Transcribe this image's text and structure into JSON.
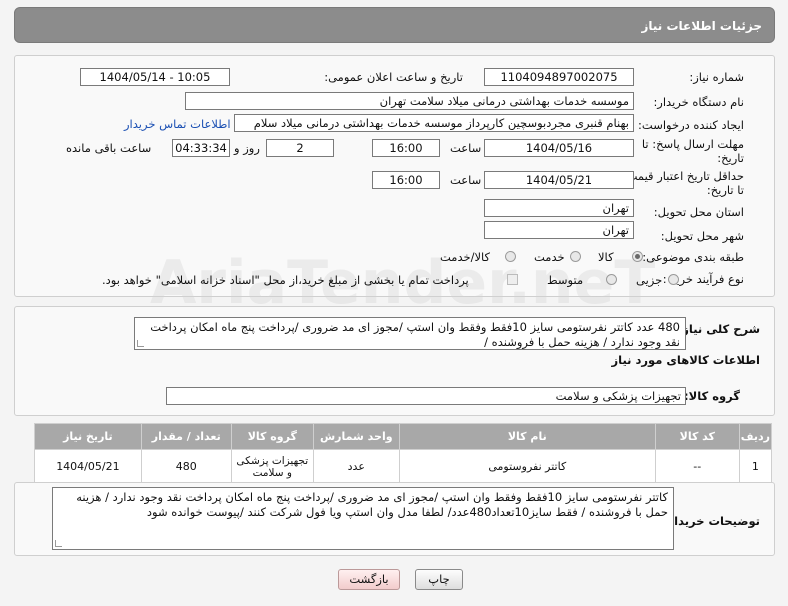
{
  "header": {
    "title": "جزئیات اطلاعات نیاز"
  },
  "fields": {
    "need_number_label": "شماره نیاز:",
    "need_number": "1104094897002075",
    "announce_label": "تاریخ و ساعت اعلان عمومی:",
    "announce_value": "1404/05/14 - 10:05",
    "buyer_label": "نام دستگاه خریدار:",
    "buyer_value": "موسسه خدمات بهداشتی درمانی میلاد سلامت تهران",
    "creator_label": "ایجاد کننده درخواست:",
    "creator_value": "بهنام قنبری مجردبوسچین کارپرداز موسسه خدمات بهداشتی درمانی میلاد سلام",
    "contact_link": "اطلاعات تماس خریدار",
    "reply_deadline_label_1": "مهلت ارسال پاسخ: تا",
    "reply_deadline_label_2": "تاریخ:",
    "reply_date": "1404/05/16",
    "time_label": "ساعت",
    "reply_time": "16:00",
    "days_value": "2",
    "days_label": "روز و",
    "remaining_time": "04:33:34",
    "remaining_label": "ساعت باقی مانده",
    "price_validity_label_1": "حداقل تاریخ اعتبار قیمت:",
    "price_validity_label_2": "تا تاریخ:",
    "price_date": "1404/05/21",
    "price_time": "16:00",
    "province_label": "استان محل تحویل:",
    "province_value": "تهران",
    "city_label": "شهر محل تحویل:",
    "city_value": "تهران",
    "category_label": "طبقه بندی موضوعی:",
    "category_options": [
      "کالا",
      "خدمت",
      "کالا/خدمت"
    ],
    "process_label": "نوع فرآیند خرید :",
    "process_options": [
      "جزیی",
      "متوسط"
    ],
    "payment_note": "پرداخت تمام یا بخشی از مبلغ خرید،از محل \"اسناد خزانه اسلامی\" خواهد بود."
  },
  "description": {
    "label": "شرح کلی نیاز:",
    "text": "480 عدد کاتتر نفرستومی سایز 10فقط  وفقط وان استپ /مجوز ای مد ضروری /پرداخت پنج ماه امکان پرداخت نقد وجود ندارد / هزینه حمل با فروشنده /"
  },
  "goods": {
    "section_title": "اطلاعات کالاهای مورد نیاز",
    "group_label": "گروه کالا:",
    "group_value": "تجهیزات پزشکی و سلامت",
    "columns": [
      "ردیف",
      "کد کالا",
      "نام کالا",
      "واحد شمارش",
      "گروه کالا",
      "تعداد / مقدار",
      "تاریخ نیاز"
    ],
    "rows": [
      [
        "1",
        "--",
        "کاتتر نفروستومی",
        "عدد",
        "تجهیزات پزشکی و سلامت",
        "480",
        "1404/05/21"
      ]
    ]
  },
  "buyer_notes": {
    "label": "توضیحات خریدار:",
    "text": "کاتتر نفرستومی سایز 10فقط  وفقط وان استپ /مجوز ای مد ضروری /پرداخت پنج ماه امکان پرداخت نقد وجود ندارد / هزینه حمل با فروشنده / فقط سایز10تعداد480عدد/ لطفا مدل وان استپ ویا فول شرکت کنند   /پیوست خوانده شود"
  },
  "buttons": {
    "print": "چاپ",
    "back": "بازگشت"
  },
  "watermark": {
    "text": "AriaTender.neT"
  }
}
